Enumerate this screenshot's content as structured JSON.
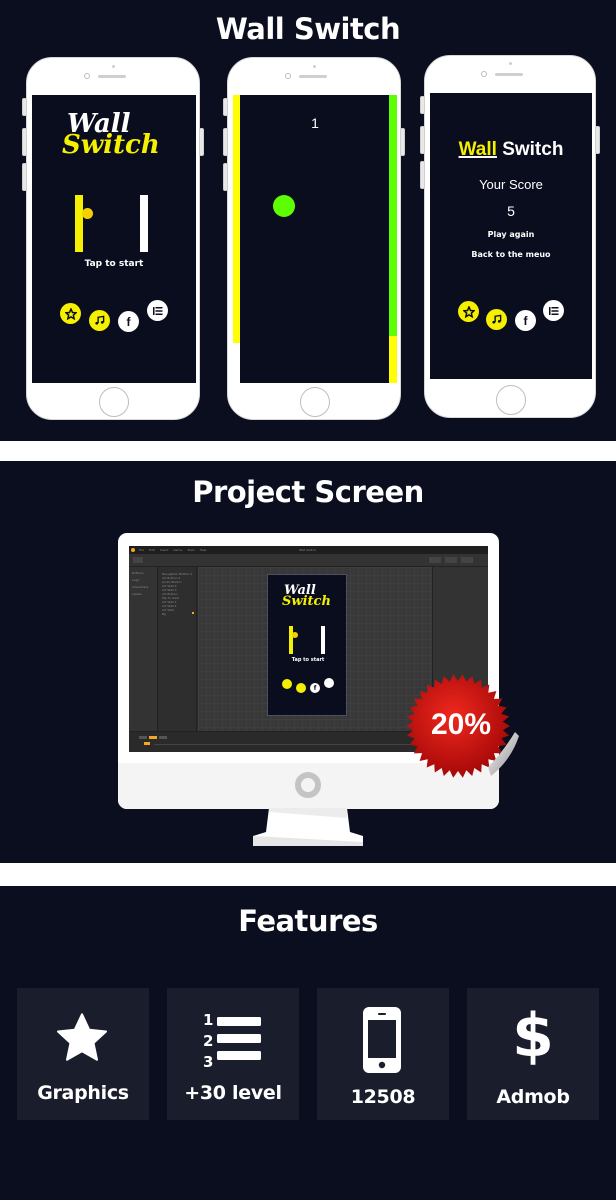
{
  "sections": {
    "showcase": {
      "title": "Wall Switch"
    },
    "project": {
      "title": "Project Screen"
    },
    "features": {
      "title": "Features"
    }
  },
  "phones": {
    "menu": {
      "logo_top": "Wall",
      "logo_bottom": "Switch",
      "tap_text": "Tap to start",
      "buttons": [
        {
          "icon": "star-icon",
          "style": "yellow"
        },
        {
          "icon": "music-note-icon",
          "style": "yellow"
        },
        {
          "icon": "facebook-icon",
          "style": "white"
        },
        {
          "icon": "leaderboard-list-icon",
          "style": "white"
        }
      ]
    },
    "gameplay": {
      "score": "1",
      "left_wall_color": "#ffff00",
      "right_wall_color": "#5dff00",
      "ball_color": "#5dff00"
    },
    "gameover": {
      "logo_word1": "Wall",
      "logo_word2": "Switch",
      "score_label": "Your Score",
      "score_value": "5",
      "play_again": "Play again",
      "back_to_menu": "Back to the meuo"
    }
  },
  "editor": {
    "menu_items": [
      "File",
      "Edit",
      "Insert",
      "Game",
      "Tools",
      "Help"
    ],
    "window_title": "Wall Switch",
    "left_panel": [
      "Buttons",
      "Logic",
      "Characters",
      "Labels"
    ],
    "tree_items": [
      "Navigation Button 2",
      "Art Button 2",
      "Audio Button",
      "Art Wall 2",
      "Art Wall 3",
      "Art Button",
      "Tap to start",
      "Art Wall 1",
      "Art Wall 4",
      "Art Wall",
      "Bg"
    ],
    "preview": {
      "logo_top": "Wall",
      "logo_bottom": "Switch",
      "tap_text": "Tap to start"
    }
  },
  "promo_badge": {
    "text": "20%",
    "color": "#d80f0f"
  },
  "features": [
    {
      "icon": "star-icon",
      "label": "Graphics"
    },
    {
      "icon": "numbered-list-icon",
      "label": "+30 level"
    },
    {
      "icon": "smartphone-icon",
      "label": "12508"
    },
    {
      "icon": "dollar-icon",
      "label": "Admob"
    }
  ],
  "colors": {
    "background": "#0b0e1e",
    "card": "#1a1d2c",
    "accent_yellow": "#f5ef00",
    "accent_green": "#5dff00"
  }
}
